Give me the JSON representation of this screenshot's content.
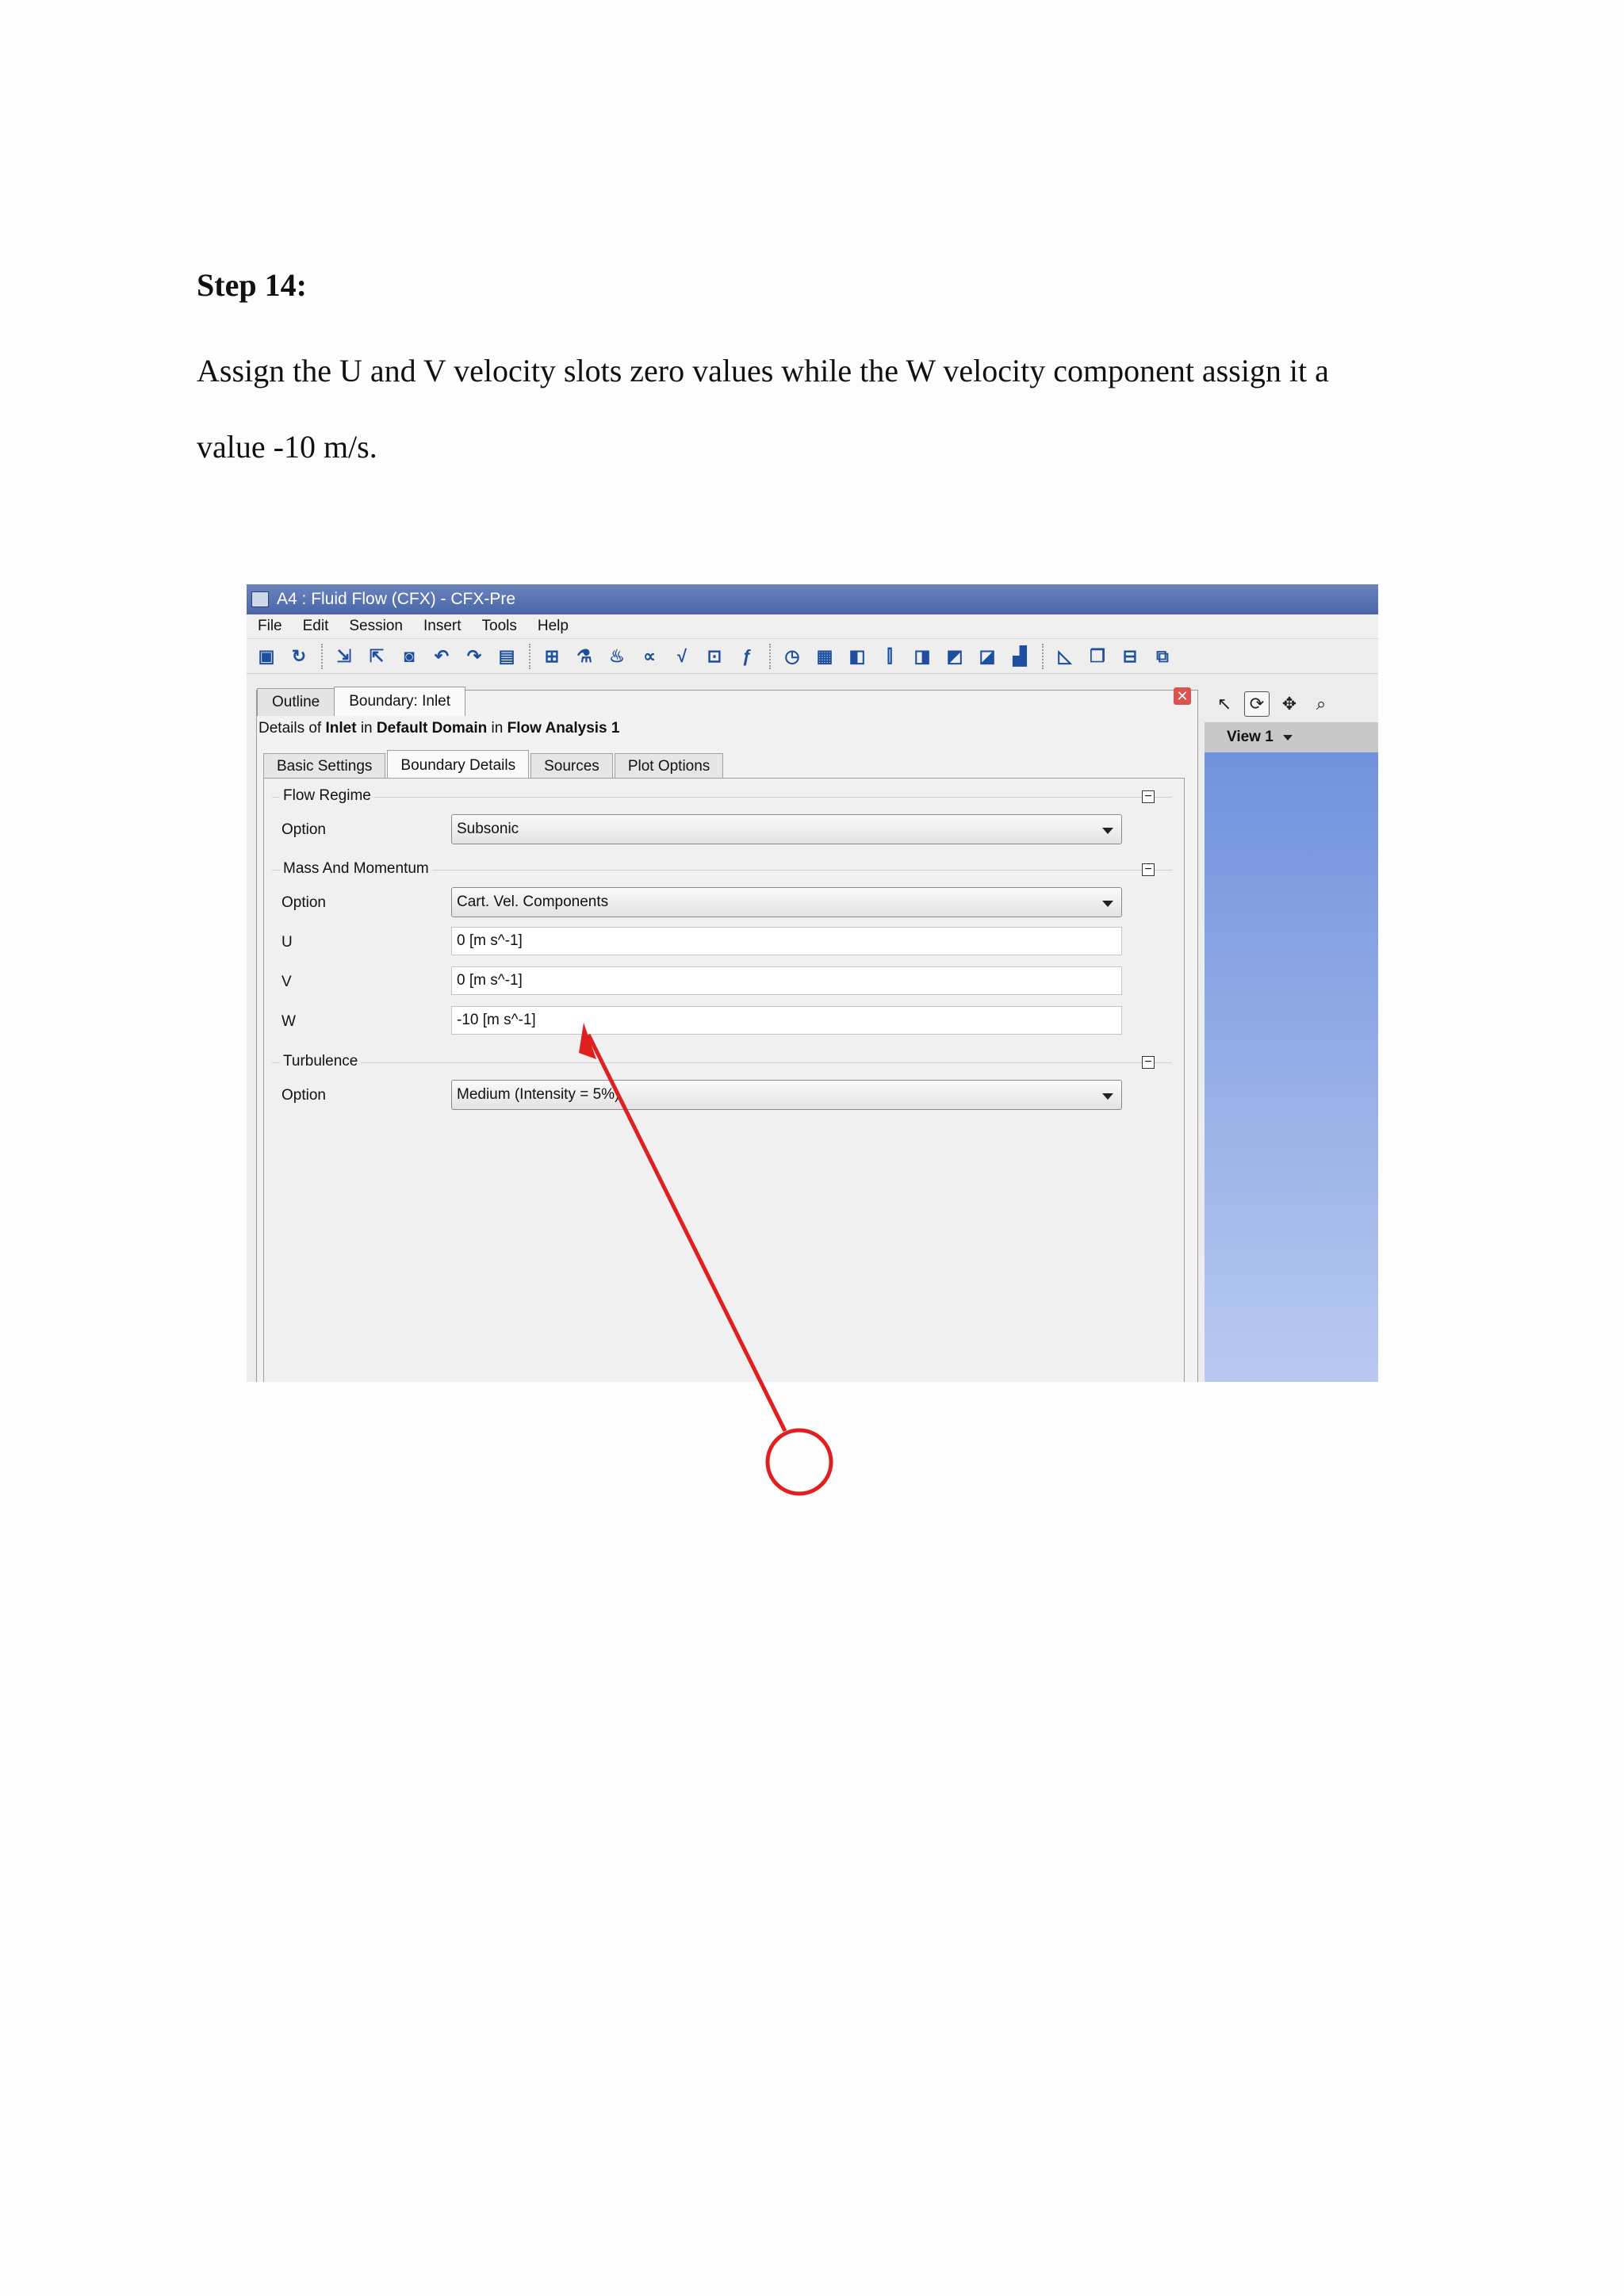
{
  "document": {
    "heading": "Step 14:",
    "paragraph_line1": "Assign the U and V velocity slots zero values while the W velocity component assign it a",
    "paragraph_line2": "value  -10 m/s."
  },
  "window": {
    "title": "A4 : Fluid Flow (CFX) - CFX-Pre",
    "menu": [
      "File",
      "Edit",
      "Session",
      "Insert",
      "Tools",
      "Help"
    ]
  },
  "toolbar_icons": [
    "save-icon",
    "refresh-icon",
    "import-icon",
    "export-icon",
    "camera-icon",
    "undo-icon",
    "redo-icon",
    "open-icon",
    "mesh-icon",
    "flask-icon",
    "flame-icon",
    "expression-icon",
    "function-icon",
    "sub-icon",
    "fx-icon",
    "clock-icon",
    "solver-icon",
    "box-icon",
    "column-icon",
    "box2-icon",
    "box3-icon",
    "box4-icon",
    "chart-icon",
    "plot-icon",
    "window-icon",
    "tile-icon",
    "copy-icon"
  ],
  "panel": {
    "tabs": [
      "Outline",
      "Boundary: Inlet"
    ],
    "details_prefix": "Details of ",
    "details_object": "Inlet",
    "details_in1": " in ",
    "details_domain": "Default Domain",
    "details_in2": " in ",
    "details_analysis": "Flow Analysis 1",
    "inner_tabs": [
      "Basic Settings",
      "Boundary Details",
      "Sources",
      "Plot Options"
    ],
    "active_inner_tab": "Boundary Details"
  },
  "form": {
    "flow_regime": {
      "title": "Flow Regime",
      "option_label": "Option",
      "option_value": "Subsonic"
    },
    "mass_momentum": {
      "title": "Mass And Momentum",
      "option_label": "Option",
      "option_value": "Cart. Vel. Components",
      "u_label": "U",
      "u_value": "0 [m s^-1]",
      "v_label": "V",
      "v_value": "0 [m s^-1]",
      "w_label": "W",
      "w_value": "-10 [m s^-1]"
    },
    "turbulence": {
      "title": "Turbulence",
      "option_label": "Option",
      "option_value": "Medium (Intensity = 5%)"
    }
  },
  "viewer": {
    "title": "View 1",
    "background_top": "#6e8fdc",
    "background_bottom": "#b9c9f0"
  },
  "annotation": {
    "color": "#e02020"
  }
}
